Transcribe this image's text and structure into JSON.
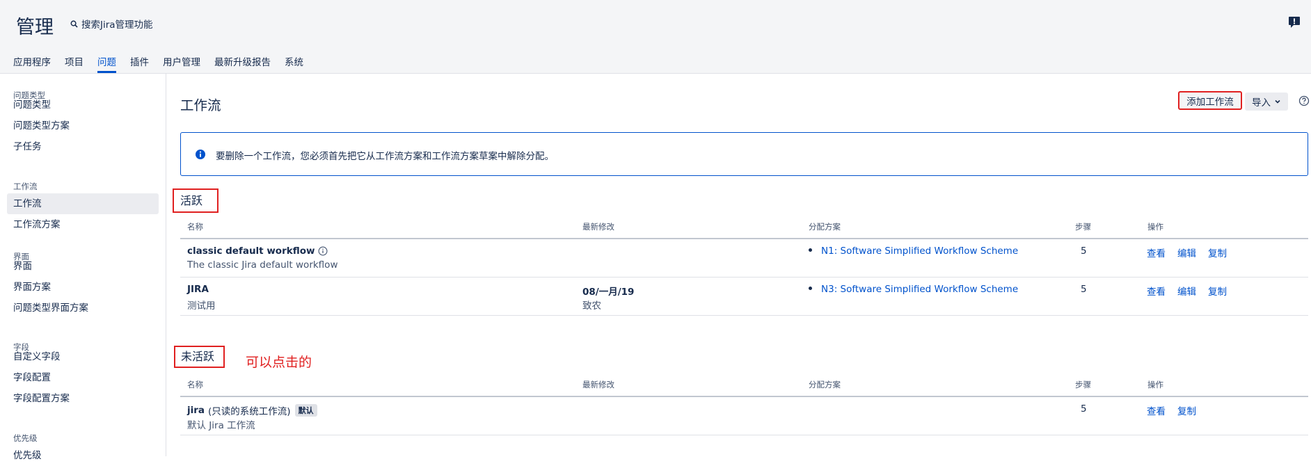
{
  "header": {
    "title": "管理",
    "search_label": "搜索Jira管理功能",
    "notification_icon": "feedback-icon"
  },
  "nav": {
    "items": [
      "应用程序",
      "项目",
      "问题",
      "插件",
      "用户管理",
      "最新升级报告",
      "系统"
    ],
    "active": "问题"
  },
  "sidebar": {
    "groups": [
      {
        "title": "问题类型",
        "items": [
          "问题类型",
          "问题类型方案",
          "子任务"
        ]
      },
      {
        "title": "工作流",
        "items": [
          "工作流",
          "工作流方案"
        ]
      },
      {
        "title": "界面",
        "items": [
          "界面",
          "界面方案",
          "问题类型界面方案"
        ]
      },
      {
        "title": "字段",
        "items": [
          "自定义字段",
          "字段配置",
          "字段配置方案"
        ]
      },
      {
        "title": "优先级",
        "items": [
          "优先级"
        ]
      }
    ],
    "active_item": "工作流"
  },
  "main": {
    "title": "工作流",
    "add_button": "添加工作流",
    "import_button": "导入",
    "info_text": "要删除一个工作流，您必须首先把它从工作流方案和工作流方案草案中解除分配。",
    "columns": [
      "名称",
      "最新修改",
      "分配方案",
      "步骤",
      "操作"
    ],
    "active_section": {
      "label": "活跃",
      "rows": [
        {
          "name": "classic default workflow",
          "description": "The classic Jira default workflow",
          "modified": "",
          "modified_by": "",
          "scheme": "N1: Software Simplified Workflow Scheme",
          "steps": "5",
          "actions": [
            "查看",
            "编辑",
            "复制"
          ]
        },
        {
          "name": "JIRA",
          "description": "测试用",
          "modified": "08/一月/19",
          "modified_by": "致农",
          "scheme": "N3: Software Simplified Workflow Scheme",
          "steps": "5",
          "actions": [
            "查看",
            "编辑",
            "复制"
          ]
        }
      ]
    },
    "inactive_section": {
      "label": "未活跃",
      "annotation": "可以点击的",
      "rows": [
        {
          "name": "jira",
          "readonly_note": "(只读的系统工作流)",
          "badge": "默认",
          "description": "默认 Jira 工作流",
          "steps": "5",
          "actions": [
            "查看",
            "复制"
          ]
        }
      ]
    }
  },
  "colors": {
    "link": "#0052cc",
    "highlight_red": "#e02020",
    "header_bg": "#f4f5f7"
  }
}
